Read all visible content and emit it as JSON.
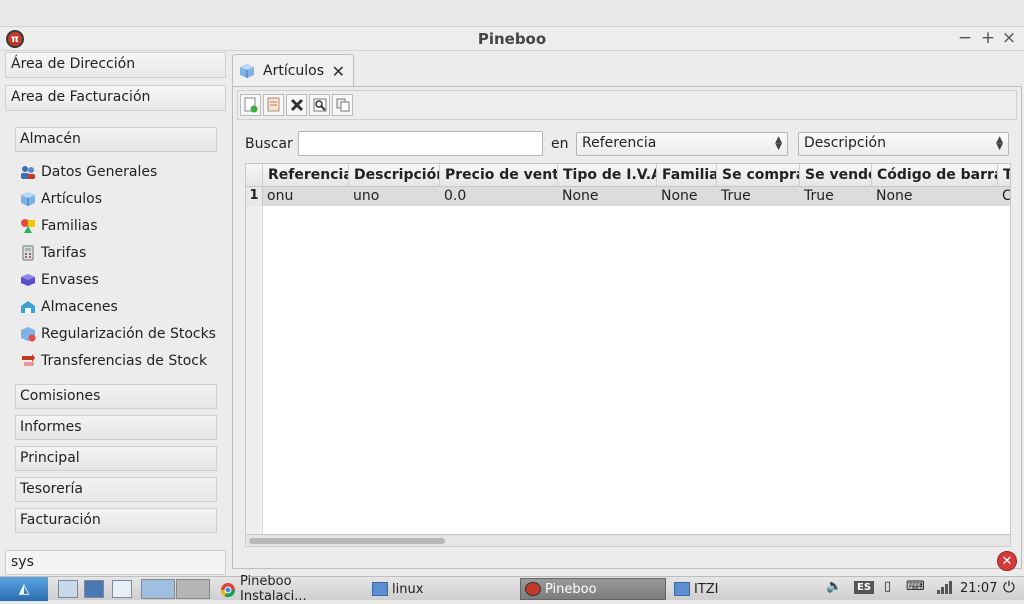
{
  "window": {
    "title": "Pineboo",
    "controls": [
      "−",
      "+",
      "×"
    ]
  },
  "sidebar": {
    "areas": [
      {
        "label": "Área de Dirección"
      },
      {
        "label": "Area de Facturación"
      }
    ],
    "sections": [
      {
        "label": "Almacén"
      },
      {
        "label": "Comisiones"
      },
      {
        "label": "Informes"
      },
      {
        "label": "Principal"
      },
      {
        "label": "Tesorería"
      },
      {
        "label": "Facturación"
      }
    ],
    "items": [
      {
        "label": "Datos Generales",
        "icon": "people-icon"
      },
      {
        "label": "Artículos",
        "icon": "cube-icon"
      },
      {
        "label": "Familias",
        "icon": "shapes-icon"
      },
      {
        "label": "Tarifas",
        "icon": "calculator-icon"
      },
      {
        "label": "Envases",
        "icon": "box-icon"
      },
      {
        "label": "Almacenes",
        "icon": "warehouse-icon"
      },
      {
        "label": "Regularización de Stocks",
        "icon": "stock-icon"
      },
      {
        "label": "Transferencias de Stock",
        "icon": "transfer-icon"
      }
    ],
    "user": "sys"
  },
  "main": {
    "tab": {
      "label": "Artículos",
      "close": "✕"
    },
    "toolbar": [
      "new-record-icon",
      "edit-record-icon",
      "delete-record-icon",
      "browse-record-icon",
      "copy-record-icon"
    ],
    "search": {
      "label": "Buscar",
      "value": "",
      "in_label": "en",
      "field": "Referencia",
      "order": "Descripción"
    },
    "table": {
      "columns": [
        "Referencia",
        "Descripción",
        "Precio de venta",
        "Tipo de I.V.A.",
        "Familia",
        "Se compra",
        "Se vende",
        "Código de barras",
        "T"
      ],
      "rows": [
        {
          "num": "1",
          "cells": [
            "onu",
            "uno",
            "0.0",
            "None",
            "None",
            "True",
            "True",
            "None",
            "C"
          ]
        }
      ]
    }
  },
  "taskbar": {
    "tasks": [
      {
        "label": "Pineboo Instalaci..."
      },
      {
        "label": "linux"
      },
      {
        "label": "Pineboo"
      },
      {
        "label": "ITZI"
      }
    ],
    "keyboard_layout": "ES",
    "clock": "21:07"
  },
  "colors": {
    "accent": "#2a6cb0",
    "exit": "#d63b3b",
    "row_selected": "#dcdcdc"
  }
}
